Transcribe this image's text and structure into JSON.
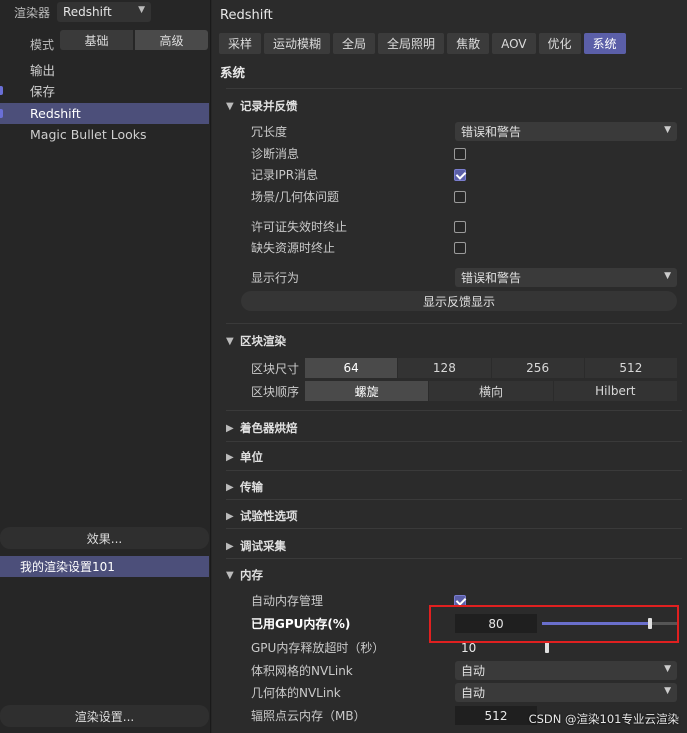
{
  "left": {
    "renderer_label": "渲染器",
    "renderer_value": "Redshift",
    "mode_label": "模式",
    "mode_options": [
      "基础",
      "高级"
    ],
    "tree": [
      "输出",
      "保存",
      "Redshift",
      "Magic Bullet Looks"
    ],
    "effects_button": "效果...",
    "preset_name": "我的渲染设置101",
    "render_settings_button": "渲染设置..."
  },
  "right": {
    "title": "Redshift",
    "tabs": [
      "采样",
      "运动模糊",
      "全局",
      "全局照明",
      "焦散",
      "AOV",
      "优化",
      "系统"
    ],
    "active_tab": "系统",
    "section_title": "系统",
    "log": {
      "group": "记录并反馈",
      "verbosity_label": "冗长度",
      "verbosity_value": "错误和警告",
      "diag_label": "诊断消息",
      "ipr_label": "记录IPR消息",
      "scene_label": "场景/几何体问题",
      "license_label": "许可证失效时终止",
      "missing_label": "缺失资源时终止",
      "display_label": "显示行为",
      "display_value": "错误和警告",
      "show_feedback_button": "显示反馈显示"
    },
    "bucket": {
      "group": "区块渲染",
      "size_label": "区块尺寸",
      "sizes": [
        "64",
        "128",
        "256",
        "512"
      ],
      "order_label": "区块顺序",
      "orders": [
        "螺旋",
        "横向",
        "Hilbert"
      ]
    },
    "collapsed_groups": [
      "着色器烘焙",
      "单位",
      "传输",
      "试验性选项",
      "调试采集"
    ],
    "memory": {
      "group": "内存",
      "auto_label": "自动内存管理",
      "gpu_label": "已用GPU内存(%)",
      "gpu_value": "80",
      "gpu_fraction": 0.8,
      "timeout_label": "GPU内存释放超时（秒）",
      "timeout_value": "10",
      "timeout_fraction": 0.02,
      "nvlink_volume_label": "体积网格的NVLink",
      "nvlink_volume_value": "自动",
      "nvlink_geo_label": "几何体的NVLink",
      "nvlink_geo_value": "自动",
      "irradiance_label": "辐照点云内存（MB）",
      "irradiance_value": "512"
    }
  },
  "watermark": "CSDN @渲染101专业云渲染",
  "colors": {
    "accent": "#5b5fa8",
    "selection": "#4c4f7a",
    "highlight": "#e02020"
  }
}
